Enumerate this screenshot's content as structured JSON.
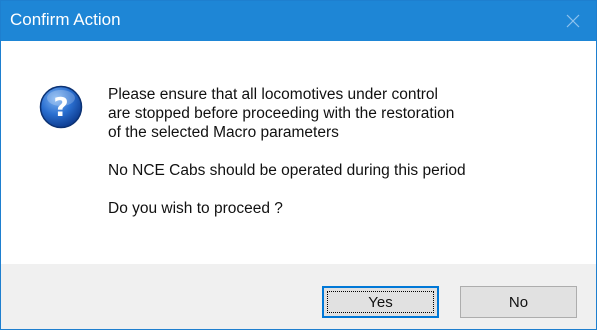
{
  "window": {
    "title": "Confirm Action"
  },
  "icons": {
    "close": "close-icon",
    "question": "question-icon"
  },
  "colors": {
    "titlebar": "#1e86d6",
    "footer": "#f0f0f0",
    "default_button_border": "#0078d7"
  },
  "message": {
    "line1": "Please ensure that all locomotives under control",
    "line2": "are stopped before proceeding with the restoration",
    "line3": "of the selected Macro parameters",
    "line4": "No NCE Cabs should be operated during this period",
    "line5": "Do you wish to proceed ?"
  },
  "buttons": {
    "yes": {
      "mnemonic": "Y",
      "rest": "es"
    },
    "no": {
      "mnemonic": "N",
      "rest": "o"
    }
  }
}
